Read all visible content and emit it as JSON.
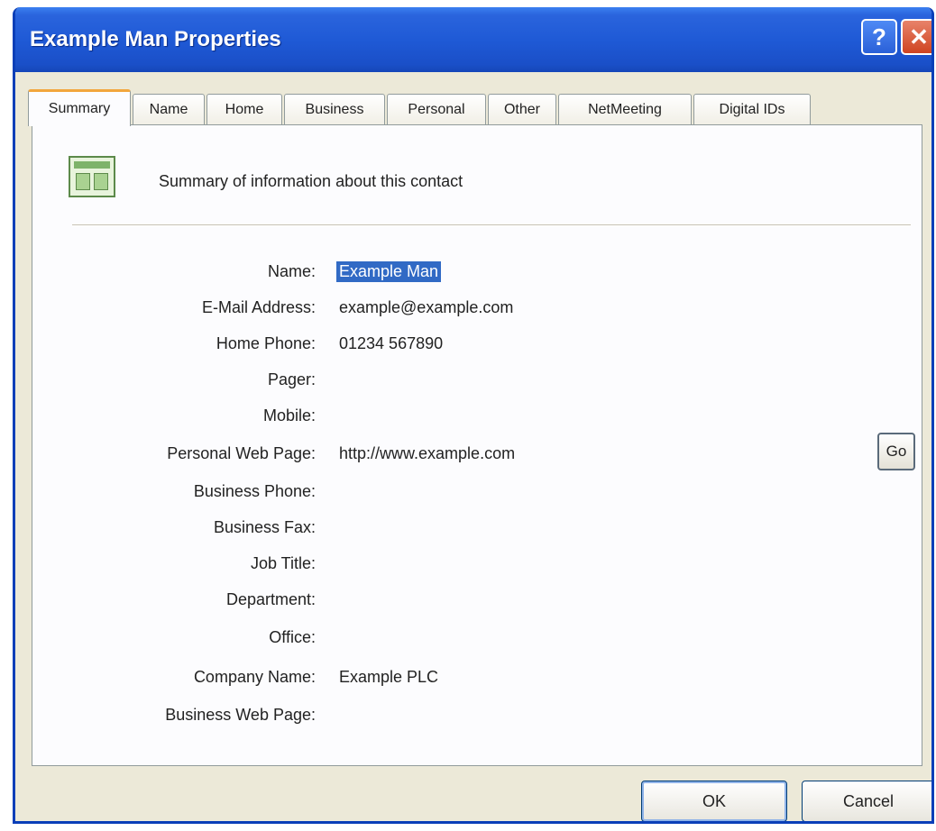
{
  "window": {
    "title": "Example Man Properties",
    "help_label": "?",
    "close_label": "✕"
  },
  "tabs": [
    {
      "label": "Summary",
      "active": true
    },
    {
      "label": "Name"
    },
    {
      "label": "Home"
    },
    {
      "label": "Business"
    },
    {
      "label": "Personal"
    },
    {
      "label": "Other"
    },
    {
      "label": "NetMeeting"
    },
    {
      "label": "Digital IDs"
    }
  ],
  "summary": {
    "header": "Summary of information about this contact"
  },
  "fields": [
    {
      "label": "Name:",
      "value": "Example Man"
    },
    {
      "label": "E-Mail Address:",
      "value": "example@example.com"
    },
    {
      "label": "Home Phone:",
      "value": "01234 567890"
    },
    {
      "label": "Pager:",
      "value": ""
    },
    {
      "label": "Mobile:",
      "value": ""
    },
    {
      "label": "Personal Web Page:",
      "value": "http://www.example.com"
    },
    {
      "label": "Business Phone:",
      "value": ""
    },
    {
      "label": "Business Fax:",
      "value": ""
    },
    {
      "label": "Job Title:",
      "value": ""
    },
    {
      "label": "Department:",
      "value": ""
    },
    {
      "label": "Office:",
      "value": ""
    },
    {
      "label": "Company Name:",
      "value": "Example PLC"
    },
    {
      "label": "Business Web Page:",
      "value": ""
    }
  ],
  "buttons": {
    "go": "Go",
    "ok": "OK",
    "cancel": "Cancel"
  },
  "colors": {
    "titlebar": "#1f5ad6",
    "selection": "#316ac5",
    "active_tab_accent": "#f2a63c"
  }
}
